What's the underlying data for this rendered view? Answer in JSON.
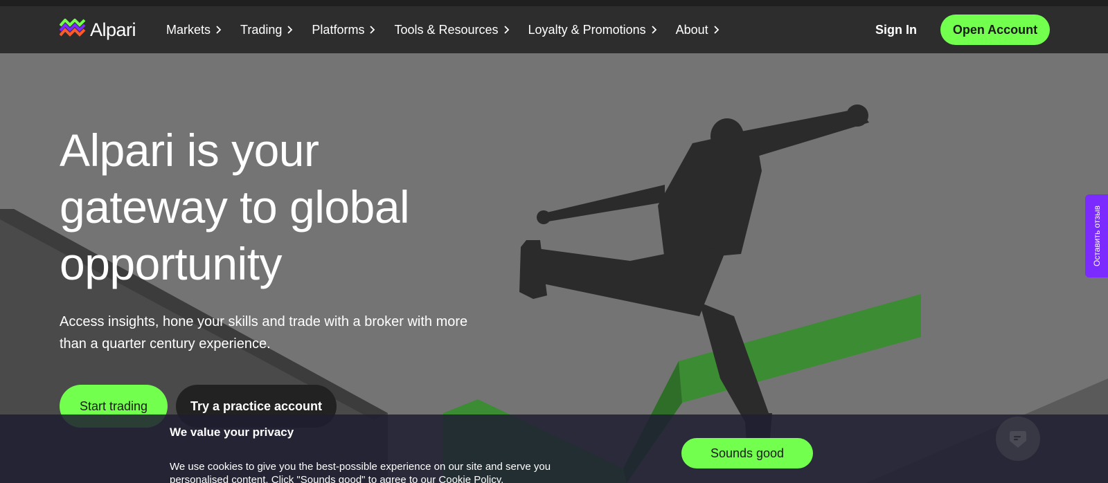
{
  "brand": {
    "name": "Alpari",
    "accent": "#73ff4e",
    "header_bg": "#2d2d2d",
    "feedback_color": "#7b2bff"
  },
  "nav": {
    "items": [
      {
        "label": "Markets"
      },
      {
        "label": "Trading"
      },
      {
        "label": "Platforms"
      },
      {
        "label": "Tools & Resources"
      },
      {
        "label": "Loyalty & Promotions"
      },
      {
        "label": "About"
      }
    ],
    "signin_label": "Sign In",
    "open_account_label": "Open Account"
  },
  "hero": {
    "title": "Alpari is your gateway to global opportunity",
    "subtitle": "Access insights, hone your skills and trade with a broker with more than a quarter century experience.",
    "start_label": "Start trading",
    "practice_label": "Try a practice account"
  },
  "feedback": {
    "label": "Оставить отзыв"
  },
  "cookie": {
    "title": "We value your privacy",
    "text": "We use cookies to give you the best-possible experience on our site and serve you personalised content. Click \"Sounds good\" to agree to our Cookie Policy.",
    "accept_label": "Sounds good"
  },
  "icons": {
    "logo": "alpari-logo-icon",
    "chevron": "chevron-right-icon",
    "chat": "chat-icon"
  }
}
